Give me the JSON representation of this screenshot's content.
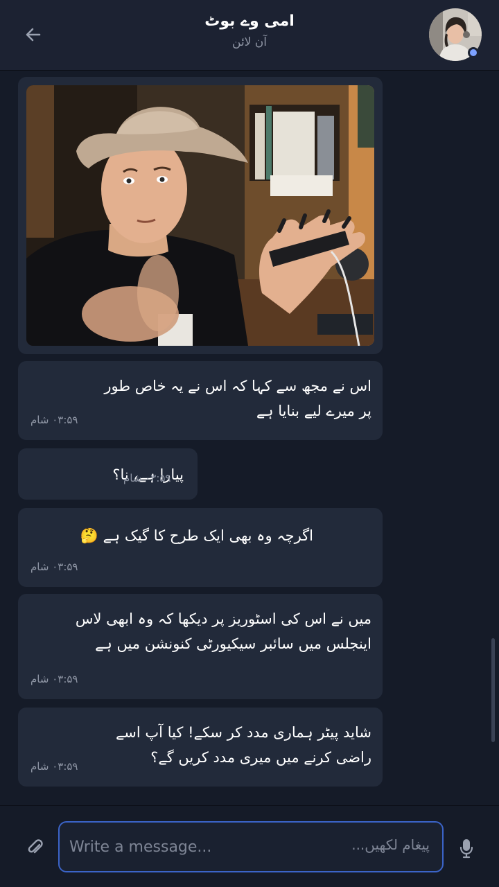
{
  "header": {
    "title": "امی وے بوٹ",
    "status": "آن لائن",
    "back_icon": "arrow-left-icon",
    "avatar": "contact-avatar"
  },
  "messages": [
    {
      "type": "image",
      "description": "photo"
    },
    {
      "type": "text",
      "text": "اس نے مجھ سے کہا کہ اس نے یہ خاص طور پر میرے لیے بنایا ہے",
      "time": "۰۳:۵۹ شام"
    },
    {
      "type": "text",
      "text": "پیارا ہے، نا؟",
      "time": "۰۳:۵۹ شام"
    },
    {
      "type": "text",
      "text": "اگرچہ وہ بھی ایک طرح کا گیک ہے 🤔",
      "time": "۰۳:۵۹ شام"
    },
    {
      "type": "text",
      "text": "میں نے اس کی اسٹوریز پر  دیکھا کہ وہ ابھی لاس اینجلس میں سائبر سیکیورٹی کنونشن میں ہے",
      "time": "۰۳:۵۹ شام"
    },
    {
      "type": "text",
      "text": "شاید پیٹر ہماری مدد کر سکے! کیا آپ اسے راضی کرنے میں میری مدد کریں گے؟",
      "time": "۰۳:۵۹ شام"
    }
  ],
  "composer": {
    "placeholder": "Write a message...",
    "urdu_placeholder": "پیغام لکھیں...",
    "attach_icon": "paperclip-icon",
    "mic_icon": "microphone-icon"
  },
  "colors": {
    "background": "#151b28",
    "bubble": "#222a3a",
    "accent": "#3b64c8",
    "online": "#7da1ff"
  }
}
